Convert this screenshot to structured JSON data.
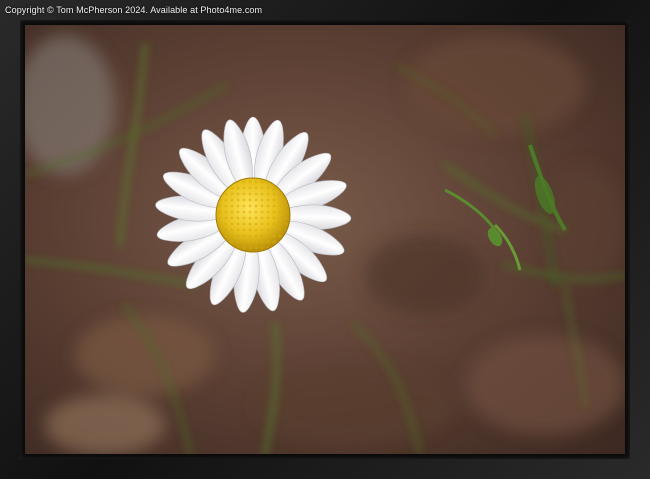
{
  "watermark": {
    "copyright_text": "Copyright © Tom McPherson 2024. Available at Photo4me.com"
  },
  "photo": {
    "subject": "daisy",
    "colors": {
      "petal": "#ffffff",
      "center": "#e8c21c",
      "stem_green": "#4f7a2a",
      "background_brown": "#6a4a3a"
    }
  },
  "frame": {
    "color": "#1a1a1a"
  }
}
